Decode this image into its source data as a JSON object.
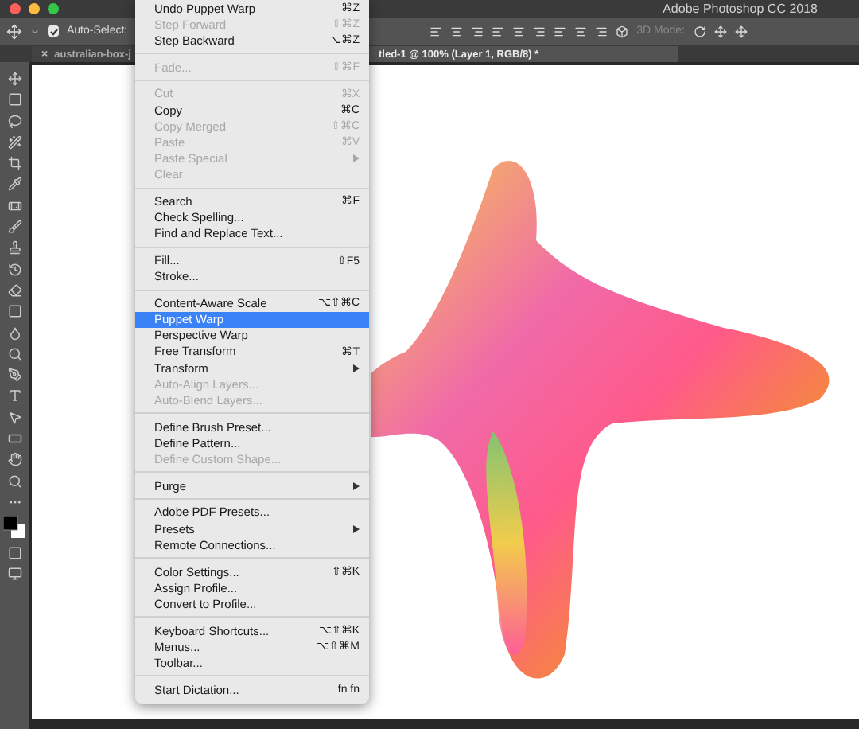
{
  "window": {
    "title": "Adobe Photoshop CC 2018"
  },
  "options_bar": {
    "auto_select": {
      "label": "Auto-Select:",
      "checked": true
    },
    "mode_label": "3D Mode:"
  },
  "tabs": [
    {
      "label": "australian-box-j",
      "close": "×",
      "selected": false
    },
    {
      "label": "tled-1 @ 100% (Layer 1, RGB/8) *",
      "selected": true
    }
  ],
  "edit_menu": [
    {
      "kind": "item",
      "label": "Undo Puppet Warp",
      "shortcut": "⌘Z",
      "disabled": false,
      "submenu": false,
      "selected": false
    },
    {
      "kind": "item",
      "label": "Step Forward",
      "shortcut": "⇧⌘Z",
      "disabled": true,
      "submenu": false,
      "selected": false
    },
    {
      "kind": "item",
      "label": "Step Backward",
      "shortcut": "⌥⌘Z",
      "disabled": false,
      "submenu": false,
      "selected": false
    },
    {
      "kind": "separator"
    },
    {
      "kind": "item",
      "label": "Fade...",
      "shortcut": "⇧⌘F",
      "disabled": true,
      "submenu": false,
      "selected": false
    },
    {
      "kind": "separator"
    },
    {
      "kind": "item",
      "label": "Cut",
      "shortcut": "⌘X",
      "disabled": true,
      "submenu": false,
      "selected": false
    },
    {
      "kind": "item",
      "label": "Copy",
      "shortcut": "⌘C",
      "disabled": false,
      "submenu": false,
      "selected": false
    },
    {
      "kind": "item",
      "label": "Copy Merged",
      "shortcut": "⇧⌘C",
      "disabled": true,
      "submenu": false,
      "selected": false
    },
    {
      "kind": "item",
      "label": "Paste",
      "shortcut": "⌘V",
      "disabled": true,
      "submenu": false,
      "selected": false
    },
    {
      "kind": "item",
      "label": "Paste Special",
      "disabled": true,
      "submenu": true,
      "selected": false
    },
    {
      "kind": "item",
      "label": "Clear",
      "disabled": true,
      "submenu": false,
      "selected": false
    },
    {
      "kind": "separator"
    },
    {
      "kind": "item",
      "label": "Search",
      "shortcut": "⌘F",
      "disabled": false,
      "submenu": false,
      "selected": false
    },
    {
      "kind": "item",
      "label": "Check Spelling...",
      "disabled": false,
      "submenu": false,
      "selected": false
    },
    {
      "kind": "item",
      "label": "Find and Replace Text...",
      "disabled": false,
      "submenu": false,
      "selected": false
    },
    {
      "kind": "separator"
    },
    {
      "kind": "item",
      "label": "Fill...",
      "shortcut": "⇧F5",
      "disabled": false,
      "submenu": false,
      "selected": false
    },
    {
      "kind": "item",
      "label": "Stroke...",
      "disabled": false,
      "submenu": false,
      "selected": false
    },
    {
      "kind": "separator"
    },
    {
      "kind": "item",
      "label": "Content-Aware Scale",
      "shortcut": "⌥⇧⌘C",
      "disabled": false,
      "submenu": false,
      "selected": false
    },
    {
      "kind": "item",
      "label": "Puppet Warp",
      "disabled": false,
      "submenu": false,
      "selected": true
    },
    {
      "kind": "item",
      "label": "Perspective Warp",
      "disabled": false,
      "submenu": false,
      "selected": false
    },
    {
      "kind": "item",
      "label": "Free Transform",
      "shortcut": "⌘T",
      "disabled": false,
      "submenu": false,
      "selected": false
    },
    {
      "kind": "item",
      "label": "Transform",
      "disabled": false,
      "submenu": true,
      "selected": false
    },
    {
      "kind": "item",
      "label": "Auto-Align Layers...",
      "disabled": true,
      "submenu": false,
      "selected": false
    },
    {
      "kind": "item",
      "label": "Auto-Blend Layers...",
      "disabled": true,
      "submenu": false,
      "selected": false
    },
    {
      "kind": "separator"
    },
    {
      "kind": "item",
      "label": "Define Brush Preset...",
      "disabled": false,
      "submenu": false,
      "selected": false
    },
    {
      "kind": "item",
      "label": "Define Pattern...",
      "disabled": false,
      "submenu": false,
      "selected": false
    },
    {
      "kind": "item",
      "label": "Define Custom Shape...",
      "disabled": true,
      "submenu": false,
      "selected": false
    },
    {
      "kind": "separator"
    },
    {
      "kind": "item",
      "label": "Purge",
      "disabled": false,
      "submenu": true,
      "selected": false
    },
    {
      "kind": "separator"
    },
    {
      "kind": "item",
      "label": "Adobe PDF Presets...",
      "disabled": false,
      "submenu": false,
      "selected": false
    },
    {
      "kind": "item",
      "label": "Presets",
      "disabled": false,
      "submenu": true,
      "selected": false
    },
    {
      "kind": "item",
      "label": "Remote Connections...",
      "disabled": false,
      "submenu": false,
      "selected": false
    },
    {
      "kind": "separator"
    },
    {
      "kind": "item",
      "label": "Color Settings...",
      "shortcut": "⇧⌘K",
      "disabled": false,
      "submenu": false,
      "selected": false
    },
    {
      "kind": "item",
      "label": "Assign Profile...",
      "disabled": false,
      "submenu": false,
      "selected": false
    },
    {
      "kind": "item",
      "label": "Convert to Profile...",
      "disabled": false,
      "submenu": false,
      "selected": false
    },
    {
      "kind": "separator"
    },
    {
      "kind": "item",
      "label": "Keyboard Shortcuts...",
      "shortcut": "⌥⇧⌘K",
      "disabled": false,
      "submenu": false,
      "selected": false
    },
    {
      "kind": "item",
      "label": "Menus...",
      "shortcut": "⌥⇧⌘M",
      "disabled": false,
      "submenu": false,
      "selected": false
    },
    {
      "kind": "item",
      "label": "Toolbar...",
      "disabled": false,
      "submenu": false,
      "selected": false
    },
    {
      "kind": "separator"
    },
    {
      "kind": "item",
      "label": "Start Dictation...",
      "shortcut": "fn fn",
      "disabled": false,
      "submenu": false,
      "selected": false
    }
  ]
}
